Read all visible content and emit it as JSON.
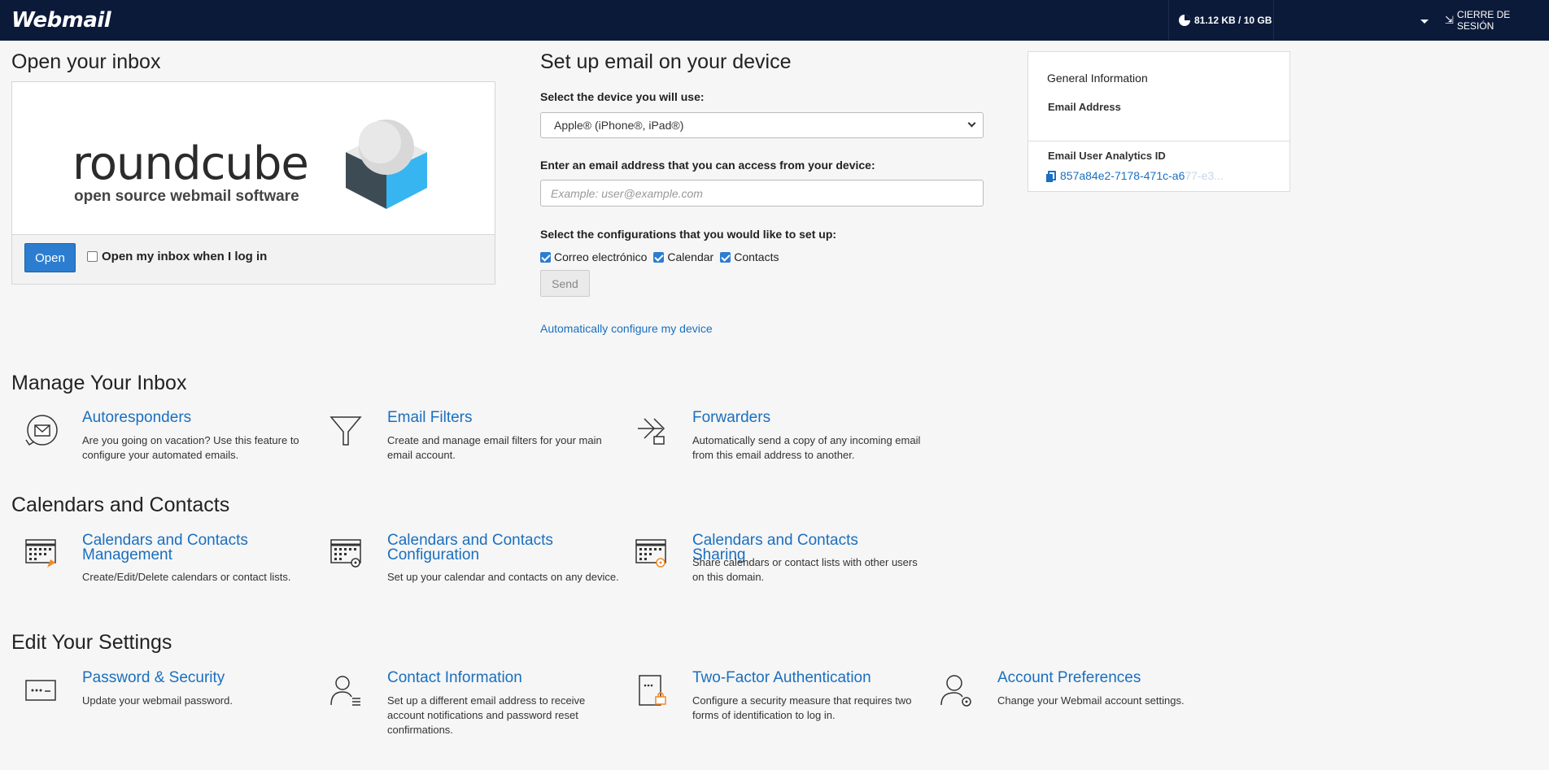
{
  "topbar": {
    "logo": "Webmail",
    "disk_usage": "81.12 KB / 10 GB",
    "logout": "CIERRE DE SESIÓN"
  },
  "inbox": {
    "heading": "Open your inbox",
    "logo_word": "roundcube",
    "logo_tagline": "open source webmail software",
    "open_button": "Open",
    "auto_open_label": "Open my inbox when I log in"
  },
  "device": {
    "heading": "Set up email on your device",
    "device_label": "Select the device you will use:",
    "device_value": "Apple® (iPhone®, iPad®)",
    "email_label": "Enter an email address that you can access from your device:",
    "email_placeholder": "Example: user@example.com",
    "config_label": "Select the configurations that you would like to set up:",
    "configs": [
      "Correo electrónico",
      "Calendar",
      "Contacts"
    ],
    "send_button": "Send",
    "auto_link": "Automatically configure my device"
  },
  "general_info": {
    "title": "General Information",
    "email_address_label": "Email Address",
    "analytics_label": "Email User Analytics ID",
    "analytics_id": "857a84e2-7178-471c-a6",
    "analytics_id_fade": "77-e3..."
  },
  "manage": {
    "heading": "Manage Your Inbox",
    "items": [
      {
        "title": "Autoresponders",
        "desc": "Are you going on vacation? Use this feature to configure your automated emails."
      },
      {
        "title": "Email Filters",
        "desc": "Create and manage email filters for your main email account."
      },
      {
        "title": "Forwarders",
        "desc": "Automatically send a copy of any incoming email from this email address to another."
      }
    ]
  },
  "calendars": {
    "heading": "Calendars and Contacts",
    "items": [
      {
        "title": "Calendars and Contacts Management",
        "desc": "Create/Edit/Delete calendars or contact lists."
      },
      {
        "title": "Calendars and Contacts Configuration",
        "desc": "Set up your calendar and contacts on any device."
      },
      {
        "title": "Calendars and Contacts Sharing",
        "desc": "Share calendars or contact lists with other users on this domain."
      }
    ]
  },
  "settings": {
    "heading": "Edit Your Settings",
    "items": [
      {
        "title": "Password & Security",
        "desc": "Update your webmail password."
      },
      {
        "title": "Contact Information",
        "desc": "Set up a different email address to receive account notifications and password reset confirmations."
      },
      {
        "title": "Two-Factor Authentication",
        "desc": "Configure a security measure that requires two forms of identification to log in."
      },
      {
        "title": "Account Preferences",
        "desc": "Change your Webmail account settings."
      }
    ]
  },
  "colors": {
    "topbar": "#0c1a3a",
    "link": "#1a6fbf",
    "accent_orange": "#f08a24",
    "roundcube_blue": "#37b5f0"
  }
}
